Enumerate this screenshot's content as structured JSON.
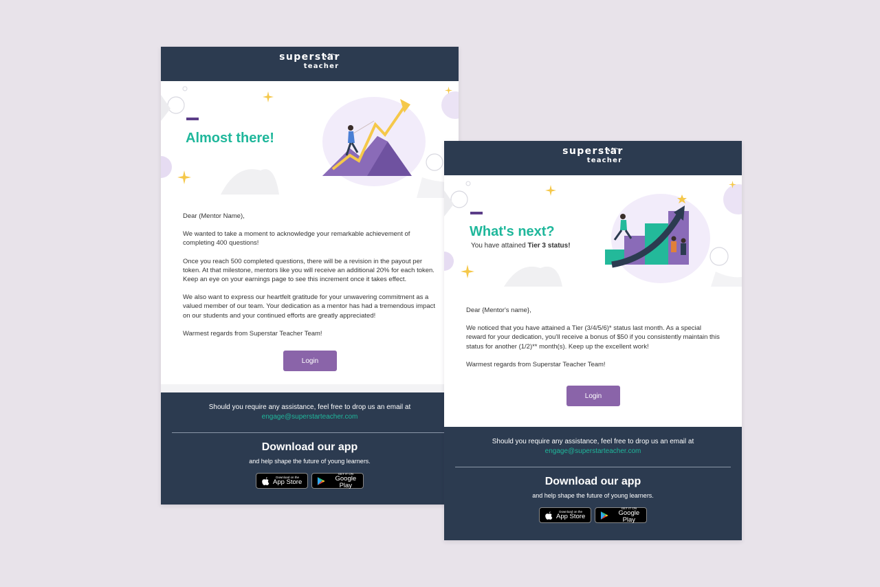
{
  "brand": {
    "logo_line1": "superstar",
    "logo_line2": "teacher"
  },
  "colors": {
    "header_bg": "#2c3b50",
    "title_green": "#1fb79b",
    "button_purple": "#8a64a9",
    "accent_purple": "#5b3d88",
    "page_bg": "#e8e3ea"
  },
  "email1": {
    "title": "Almost there!",
    "greeting": "Dear (Mentor Name),",
    "p1": "We wanted to take a moment to acknowledge your remarkable achievement of completing 400 questions!",
    "p2": "Once you reach 500 completed questions, there will be a revision in the payout per token. At that milestone, mentors like you will receive an additional 20% for each token. Keep an eye on your earnings page to see this increment once it takes effect.",
    "p3": "We also want to express our heartfelt gratitude for your unwavering commitment as a valued member of our team. Your dedication as a mentor has had a tremendous impact on our students and your continued efforts are greatly appreciated!",
    "signoff": "Warmest regards from Superstar Teacher Team!",
    "login_label": "Login"
  },
  "email2": {
    "title": "What's next?",
    "subtitle_prefix": "You have attained ",
    "subtitle_bold": "Tier 3 status!",
    "greeting": "Dear {Mentor's name},",
    "p1": "We noticed that you have attained a Tier (3/4/5/6)* status last month. As a special reward for your dedication, you'll receive a bonus of $50 if you consistently maintain this status for another (1/2)** month(s). Keep up the excellent work!",
    "signoff": "Warmest regards from Superstar Teacher Team!",
    "login_label": "Login"
  },
  "footer": {
    "assist_text": "Should you require any assistance, feel free to drop us an email at",
    "email": "engage@superstarteacher.com",
    "download_title": "Download our app",
    "download_sub": "and help shape the future of young learners.",
    "appstore_small": "Download on the",
    "appstore_big": "App Store",
    "googleplay_small": "GET IT ON",
    "googleplay_big": "Google Play"
  },
  "icons": [
    "sparkle-icon",
    "apple-icon",
    "google-play-icon",
    "stars-icon"
  ]
}
